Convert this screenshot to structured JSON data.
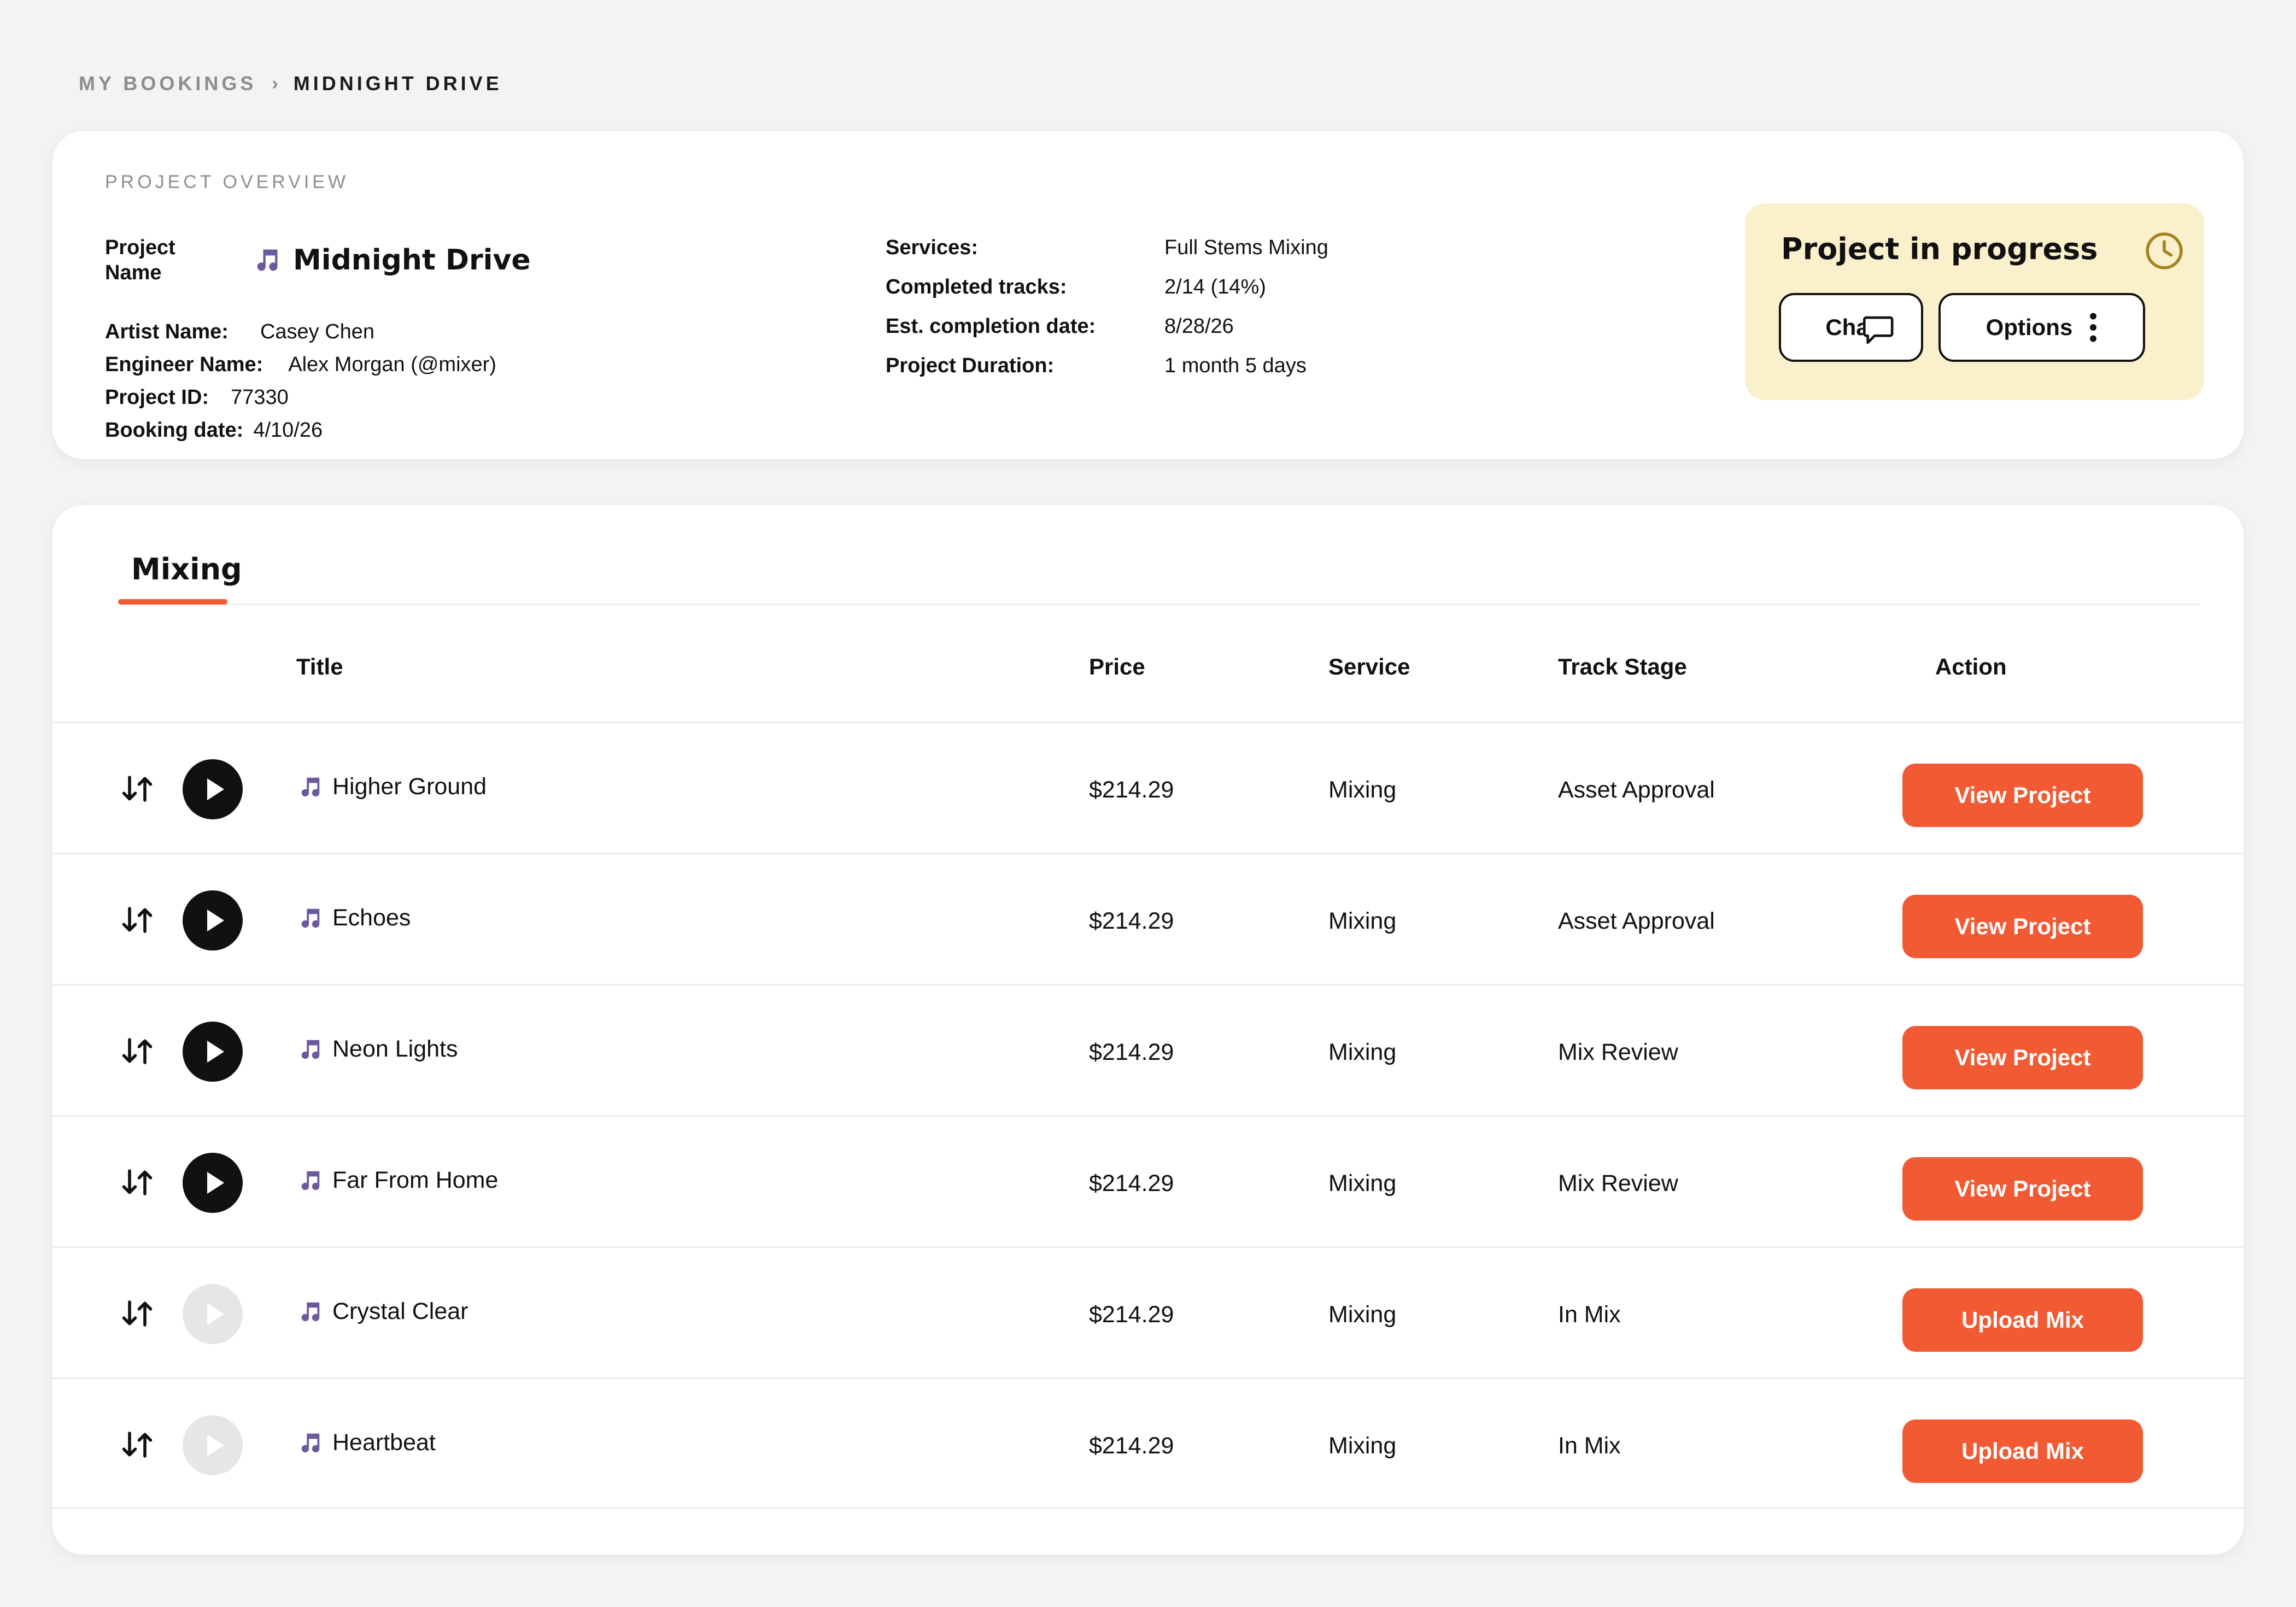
{
  "breadcrumb": {
    "parent": "MY BOOKINGS",
    "separator": "›",
    "current": "MIDNIGHT DRIVE"
  },
  "overview": {
    "section_title": "PROJECT OVERVIEW",
    "project_name_label": "Project Name",
    "project_name": "Midnight Drive",
    "artist_label": "Artist Name:",
    "artist": "Casey Chen",
    "engineer_label": "Engineer Name:",
    "engineer": "Alex Morgan (@mixer)",
    "project_id_label": "Project ID:",
    "project_id": "77330",
    "booking_date_label": "Booking date:",
    "booking_date": "4/10/26",
    "services_label": "Services:",
    "services": "Full Stems Mixing",
    "completed_label": "Completed tracks:",
    "completed": "2/14 (14%)",
    "est_label": "Est. completion date:",
    "est": "8/28/26",
    "duration_label": "Project Duration:",
    "duration": "1 month 5 days"
  },
  "status": {
    "title": "Project in progress",
    "chat_label": "Chat",
    "options_label": "Options",
    "colors": {
      "panel": "#faf0cc",
      "clock": "#a3821f"
    }
  },
  "tabs": [
    {
      "label": "Mixing",
      "active": true
    }
  ],
  "table": {
    "headers": {
      "title": "Title",
      "price": "Price",
      "service": "Service",
      "stage": "Track Stage",
      "action": "Action"
    },
    "rows": [
      {
        "title": "Higher Ground",
        "price": "$214.29",
        "service": "Mixing",
        "stage": "Asset Approval",
        "action": "View Project",
        "playable": true
      },
      {
        "title": "Echoes",
        "price": "$214.29",
        "service": "Mixing",
        "stage": "Asset Approval",
        "action": "View Project",
        "playable": true
      },
      {
        "title": "Neon Lights",
        "price": "$214.29",
        "service": "Mixing",
        "stage": "Mix Review",
        "action": "View Project",
        "playable": true
      },
      {
        "title": "Far From Home",
        "price": "$214.29",
        "service": "Mixing",
        "stage": "Mix Review",
        "action": "View Project",
        "playable": true
      },
      {
        "title": "Crystal Clear",
        "price": "$214.29",
        "service": "Mixing",
        "stage": "In Mix",
        "action": "Upload Mix",
        "playable": false
      },
      {
        "title": "Heartbeat",
        "price": "$214.29",
        "service": "Mixing",
        "stage": "In Mix",
        "action": "Upload Mix",
        "playable": false
      }
    ]
  },
  "icons": {
    "music_note": "music-note-icon",
    "sort": "sort-arrows-icon",
    "play": "play-icon",
    "clock": "clock-icon",
    "chat": "chat-bubble-icon",
    "more": "vertical-dots-icon"
  },
  "accent_color": "#f15a32",
  "note_color": "#6b5a9e"
}
